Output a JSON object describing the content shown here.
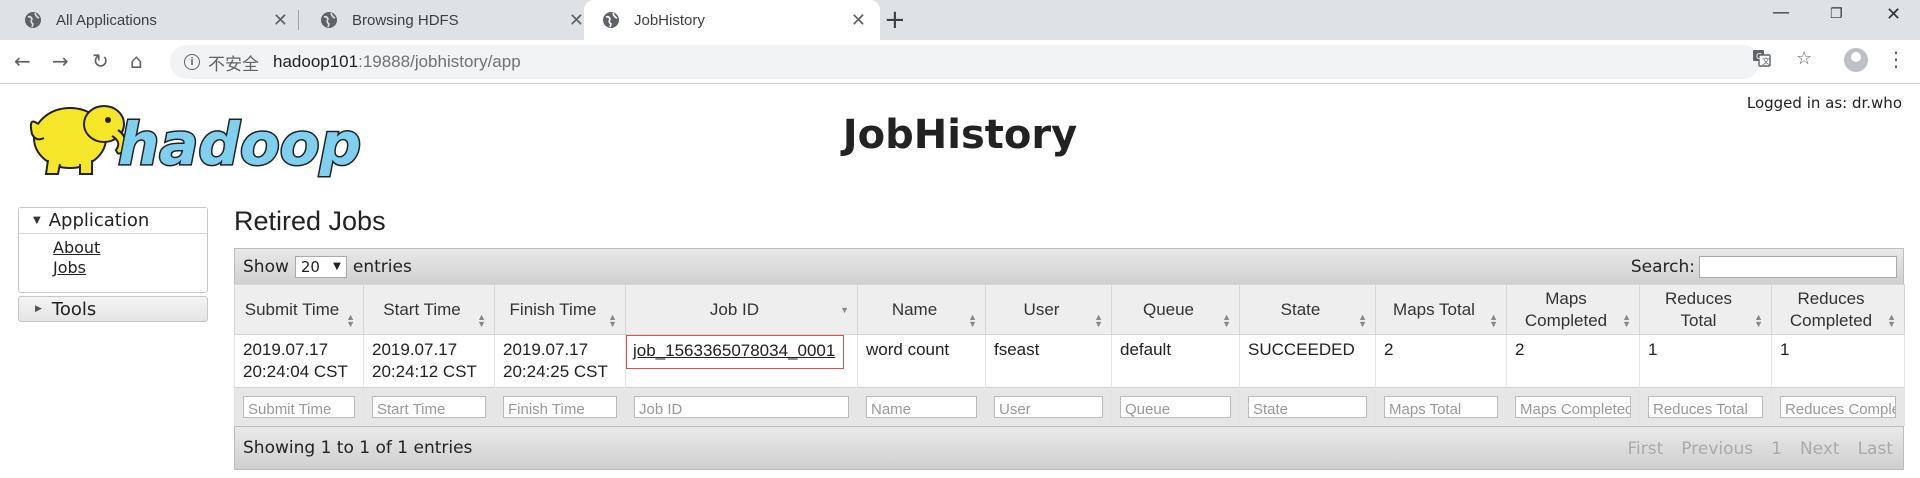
{
  "browser": {
    "tabs": [
      {
        "title": "All Applications"
      },
      {
        "title": "Browsing HDFS"
      },
      {
        "title": "JobHistory"
      }
    ],
    "address": {
      "security_label": "不安全",
      "host": "hadoop101",
      "rest": ":19888/jobhistory/app"
    }
  },
  "page": {
    "title": "JobHistory",
    "logged_in": "Logged in as: dr.who",
    "logo_text": "hadoop"
  },
  "nav": {
    "application": {
      "label": "Application",
      "links": [
        "About",
        "Jobs"
      ]
    },
    "tools": {
      "label": "Tools"
    }
  },
  "section": {
    "title": "Retired Jobs"
  },
  "datatable": {
    "show_label": "Show",
    "page_length": "20",
    "entries_label": "entries",
    "search_label": "Search:",
    "columns": [
      {
        "label": "Submit Time",
        "sort": "both"
      },
      {
        "label": "Start Time",
        "sort": "both"
      },
      {
        "label": "Finish Time",
        "sort": "both"
      },
      {
        "label": "Job ID",
        "sort": "desc"
      },
      {
        "label": "Name",
        "sort": "both"
      },
      {
        "label": "User",
        "sort": "both"
      },
      {
        "label": "Queue",
        "sort": "both"
      },
      {
        "label": "State",
        "sort": "both"
      },
      {
        "label": "Maps Total",
        "sort": "both"
      },
      {
        "label": "Maps Completed",
        "sort": "both"
      },
      {
        "label": "Reduces Total",
        "sort": "both"
      },
      {
        "label": "Reduces Completed",
        "sort": "both"
      }
    ],
    "rows": [
      {
        "submit_time": "2019.07.17 20:24:04 CST",
        "start_time": "2019.07.17 20:24:12 CST",
        "finish_time": "2019.07.17 20:24:25 CST",
        "job_id": "job_1563365078034_0001",
        "name": "word count",
        "user": "fseast",
        "queue": "default",
        "state": "SUCCEEDED",
        "maps_total": "2",
        "maps_completed": "2",
        "reduces_total": "1",
        "reduces_completed": "1"
      }
    ],
    "filters": [
      "Submit Time",
      "Start Time",
      "Finish Time",
      "Job ID",
      "Name",
      "User",
      "Queue",
      "State",
      "Maps Total",
      "Maps Completed",
      "Reduces Total",
      "Reduces Completed"
    ],
    "info": "Showing 1 to 1 of 1 entries",
    "pager": {
      "first": "First",
      "previous": "Previous",
      "page": "1",
      "next": "Next",
      "last": "Last"
    }
  },
  "colors": {
    "job_highlight": "#d9534f",
    "tab_bar": "#dee1e6"
  }
}
